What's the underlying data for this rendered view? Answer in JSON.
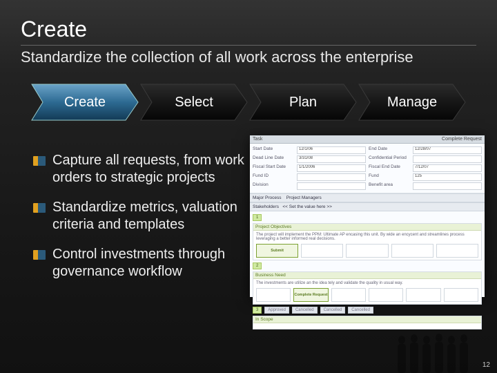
{
  "title": "Create",
  "subtitle": "Standardize the collection of all work across the enterprise",
  "chevrons": [
    "Create",
    "Select",
    "Plan",
    "Manage"
  ],
  "activeChevron": 0,
  "bullets": [
    "Capture all requests, from work orders to strategic projects",
    "Standardize metrics, valuation criteria and templates",
    "Control investments through governance workflow"
  ],
  "form": {
    "rows": [
      {
        "k1": "Start Date",
        "v1": "12/1/06",
        "k2": "End Date",
        "v2": "12/28/07"
      },
      {
        "k1": "Dead Line Date",
        "v1": "3/31/08",
        "k2": "Confidential Period",
        "v2": ""
      },
      {
        "k1": "Fiscal Start Date",
        "v1": "1/1/2006",
        "k2": "Fiscal End Date",
        "v2": "7/12/07"
      },
      {
        "k1": "Fund ID",
        "v1": "",
        "k2": "Fund",
        "v2": "125"
      },
      {
        "k1": "Division",
        "v1": "",
        "k2": "Benefit area",
        "v2": ""
      }
    ],
    "line": {
      "k1": "Major Process",
      "v1": "",
      "k2": "Project Managers",
      "v2": ""
    },
    "stakeVal": "<< Set the value here >>"
  },
  "panels": {
    "p1": {
      "title": "Project Objectives",
      "text": "The project will implement the PPM: Ultimate AP encasing this unit. By wide an encycent and streamlines process leveraging a better informed real decisions."
    },
    "boxes1": [
      "Submit",
      "",
      "",
      "",
      ""
    ],
    "p2": {
      "title": "Business Need",
      "text": "The investments are utilize an the idea tely and validate the quality in usual way."
    },
    "boxes2": [
      "",
      "Complete Request",
      "",
      "",
      "",
      ""
    ],
    "p3": {
      "title": "In Scope"
    },
    "boxes3": [
      "",
      "",
      "",
      "",
      ""
    ]
  },
  "tabs": [
    "Approved",
    "Cancelled",
    "Cancelled",
    "Cancelled"
  ],
  "hdr": {
    "left": "Task",
    "right": "Complete Request"
  },
  "pageNumber": "12"
}
